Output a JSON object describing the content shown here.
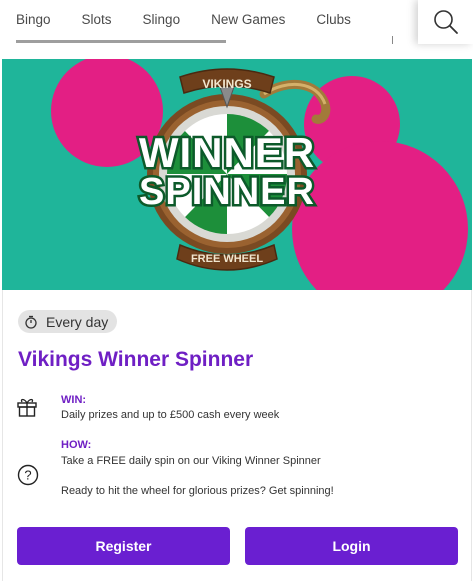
{
  "nav": {
    "tabs": [
      {
        "label": "Bingo"
      },
      {
        "label": "Slots"
      },
      {
        "label": "Slingo"
      },
      {
        "label": "New Games"
      },
      {
        "label": "Clubs"
      }
    ],
    "search_icon": "search-icon"
  },
  "banner": {
    "logo_top": "VIKINGS",
    "logo_line1": "WINNER",
    "logo_line2": "SPINNER",
    "logo_bottom": "FREE WHEEL",
    "colors": {
      "background": "#1fb59a",
      "circles": "#e31f84"
    }
  },
  "promo": {
    "badge": "Every day",
    "badge_icon": "stopwatch-icon",
    "title": "Vikings Winner Spinner",
    "win_label": "WIN:",
    "win_text": "Daily prizes and up to £500 cash every week",
    "how_label": "HOW:",
    "how_text": "Take a FREE daily spin on our Viking Winner Spinner",
    "how_text_2": "Ready to hit the wheel for glorious prizes? Get spinning!",
    "accent": "#6f1fc4"
  },
  "actions": {
    "register_label": "Register",
    "login_label": "Login",
    "button_color": "#6a1fd1"
  }
}
